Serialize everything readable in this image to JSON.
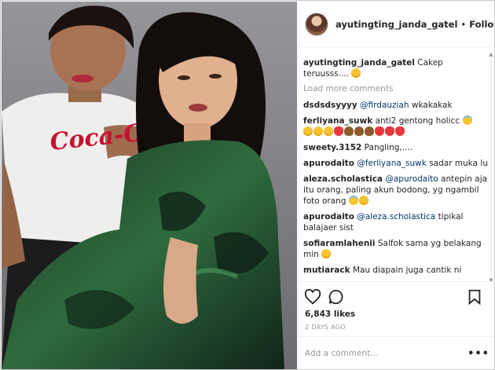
{
  "header": {
    "username": "ayutingting_janda_gatel",
    "separator": "•",
    "follow_label": "Following"
  },
  "caption": {
    "username": "ayutingting_janda_gatel",
    "text": "Cakep teruusss....",
    "emoji": "heart-eyes"
  },
  "load_more": "Load more comments",
  "comments": [
    {
      "username": "dsdsdsyyyy",
      "mention": "@firdauziah",
      "text": "wkakakak"
    },
    {
      "username": "ferliyana_suwk",
      "mention": "",
      "text": "anti2 gentong holicc",
      "emoji": "grin-sweat"
    },
    {
      "username": "sweety.3152",
      "mention": "",
      "text": "Pangling,...."
    },
    {
      "username": "apurodaito",
      "mention": "@ferliyana_suwk",
      "text": "sadar muka lu"
    },
    {
      "username": "aleza.scholastica",
      "mention": "@apurodaito",
      "text": "antepin aja itu orang, paling akun bodong, yg ngambil foto orang"
    },
    {
      "username": "apurodaito",
      "mention": "@aleza.scholastica",
      "text": "tipikal balajaer sist"
    },
    {
      "username": "sofiaramlahenii",
      "mention": "",
      "text": "Salfok sama yg belakang min"
    },
    {
      "username": "mutiarack",
      "mention": "",
      "text": "Mau diapain juga cantik ni"
    }
  ],
  "likes": "6,843 likes",
  "time": "2 DAYS AGO",
  "add_comment": {
    "placeholder": "Add a comment...",
    "more": "•••"
  },
  "photo": {
    "shirt_text": "Coca-Cola"
  },
  "icons": [
    "heart-icon",
    "comment-icon",
    "bookmark-icon",
    "more-options-icon"
  ],
  "colors": {
    "link": "#003569",
    "muted": "#999999",
    "text": "#262626",
    "shirt_logo": "#c8102e"
  }
}
